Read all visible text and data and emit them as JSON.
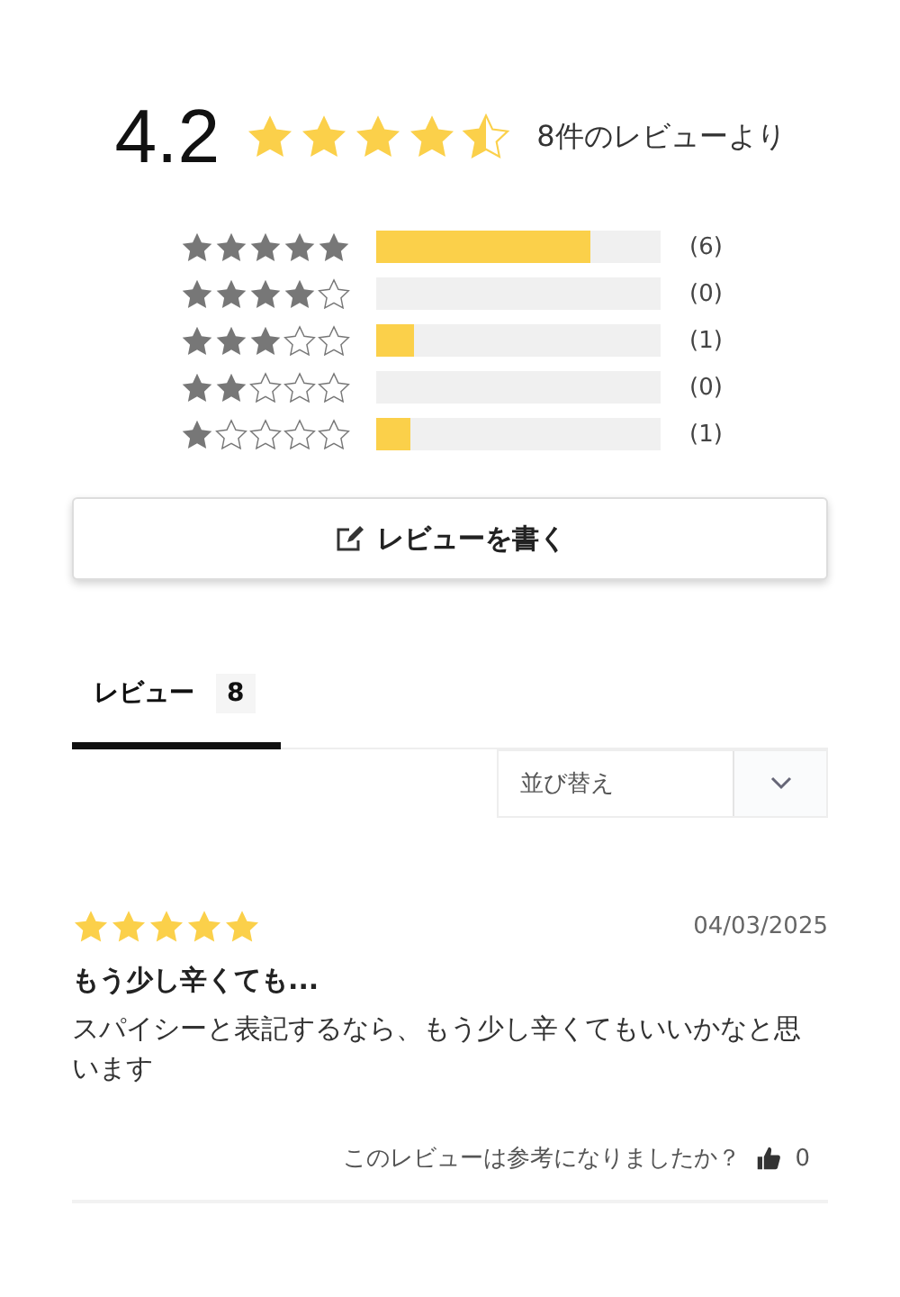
{
  "summary": {
    "average": "4.2",
    "stars": 4.5,
    "caption": "8件のレビューより"
  },
  "distribution": [
    {
      "stars": 5,
      "level": 0.75,
      "count": "(6)"
    },
    {
      "stars": 4,
      "count": "(0)"
    },
    {
      "stars": 3,
      "level": 0.13,
      "count": "(1)"
    },
    {
      "stars": 2,
      "count": "(0)"
    },
    {
      "stars": 1,
      "level": 0.12,
      "count": "(1)"
    }
  ],
  "write_button": {
    "label": "レビューを書く"
  },
  "tabs": [
    {
      "label": "レビュー",
      "count": "8",
      "selected": true
    }
  ],
  "sort": {
    "placeholder": "並び替え"
  },
  "reviews": [
    {
      "stars": 5,
      "date": "04/03/2025",
      "title": "もう少し辛くても...",
      "body": "スパイシーと表記するなら、もう少し辛くてもいいかなと思います",
      "helpful_prompt": "このレビューは参考になりましたか？",
      "helpful_count": "0"
    }
  ]
}
